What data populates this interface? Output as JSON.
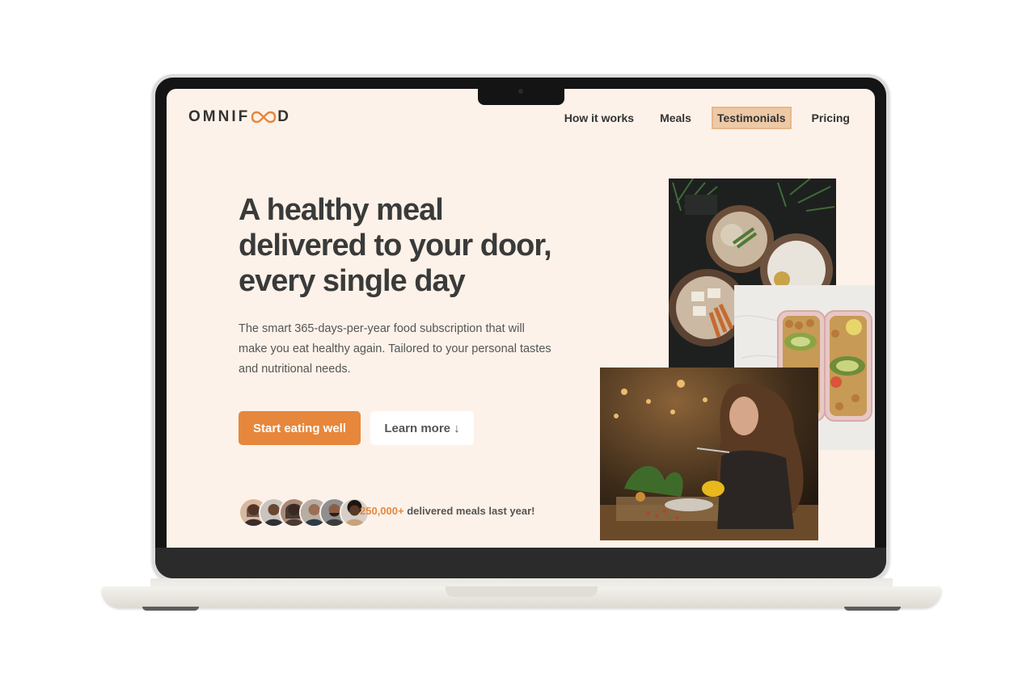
{
  "brand": {
    "name": "OMNIFOOD",
    "prefix": "OMNIF",
    "suffix": "D"
  },
  "nav": {
    "items": [
      {
        "label": "How it works"
      },
      {
        "label": "Meals"
      },
      {
        "label": "Testimonials"
      },
      {
        "label": "Pricing"
      }
    ],
    "active_index": 2
  },
  "hero": {
    "headline": "A healthy meal delivered to your door, every single day",
    "description": "The smart 365-days-per-year food subscription that will make you eat healthy again. Tailored to your personal tastes and nutritional needs.",
    "primary_cta": "Start eating well",
    "secondary_cta": "Learn more ↓",
    "social_proof": {
      "highlight": "250,000+",
      "text": " delivered meals last year!"
    }
  },
  "colors": {
    "accent": "#e6873c",
    "background": "#fdf2e9",
    "nav_active": "#edc9a6",
    "text_dark": "#333333"
  },
  "images": {
    "bowls": "food-bowls-photo",
    "boxes": "meal-prep-boxes-photo",
    "woman": "woman-eating-photo",
    "avatars": [
      "customer-avatar-1",
      "customer-avatar-2",
      "customer-avatar-3",
      "customer-avatar-4",
      "customer-avatar-5",
      "customer-avatar-6"
    ]
  }
}
